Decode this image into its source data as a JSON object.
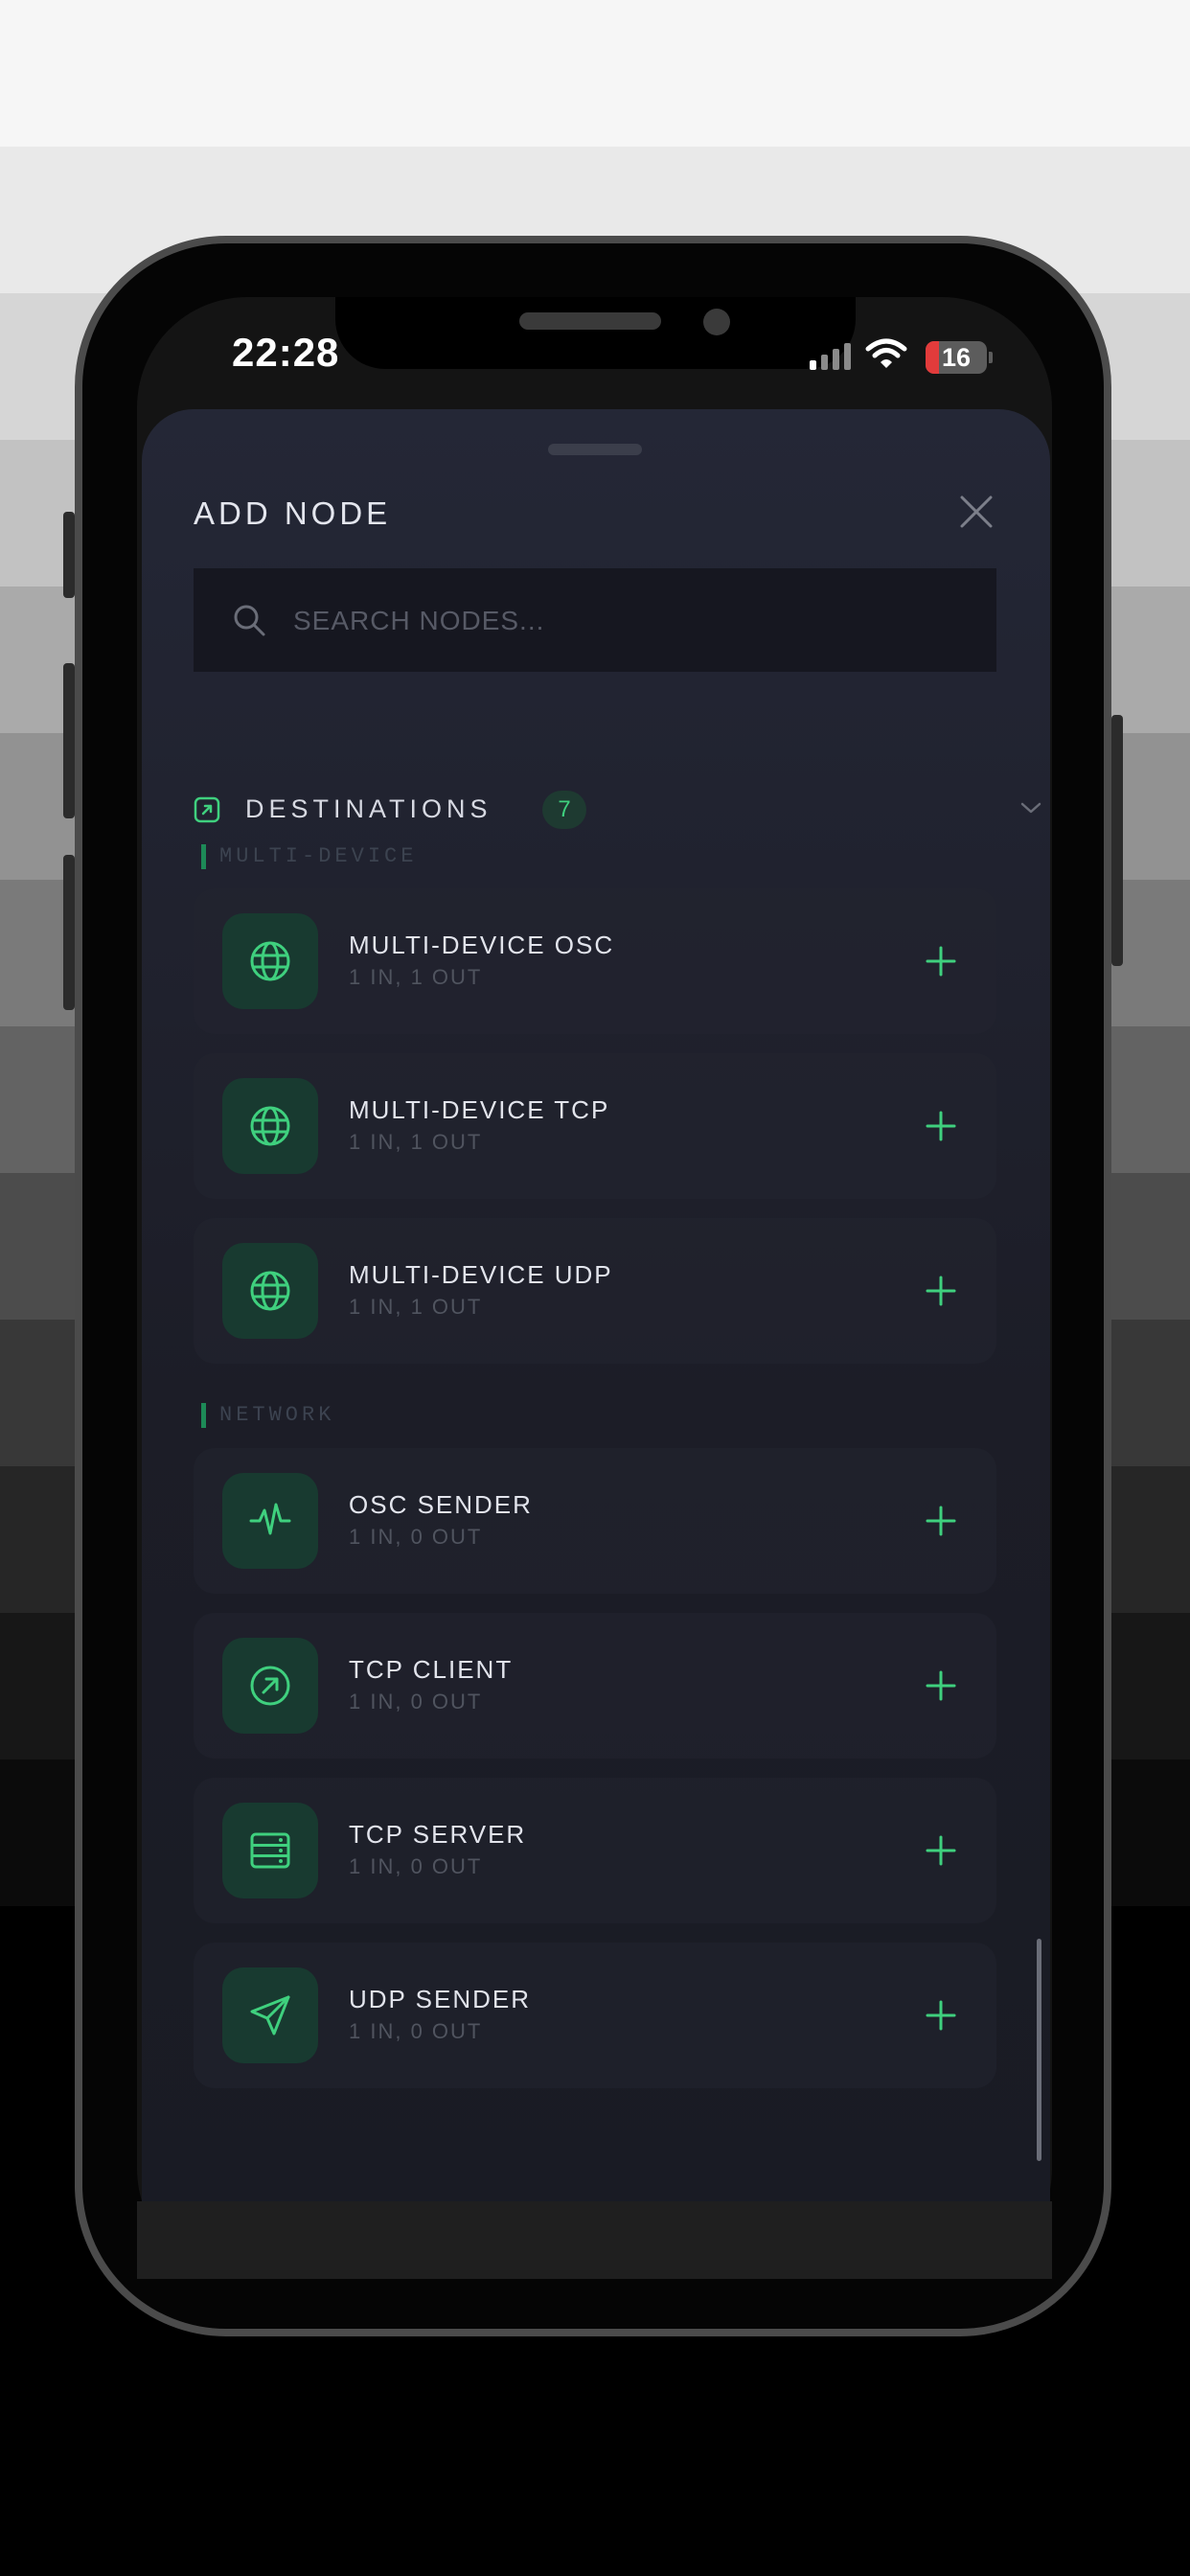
{
  "status_bar": {
    "time": "22:28",
    "battery_level": "16",
    "battery_color": "#e23b3b",
    "icons": [
      "signal-icon",
      "wifi-icon",
      "battery-icon"
    ]
  },
  "sheet": {
    "title": "ADD NODE",
    "close_icon": "close-icon",
    "search_placeholder": "SEARCH NODES...",
    "search_value": ""
  },
  "category": {
    "label": "DESTINATIONS",
    "count": "7",
    "icon": "arrow-up-right-square-icon",
    "expanded_icon": "chevron-down-icon"
  },
  "groups": [
    {
      "label": "MULTI-DEVICE",
      "nodes": [
        {
          "name": "MULTI-DEVICE OSC",
          "ports": "1 IN, 1 OUT",
          "icon": "globe-icon"
        },
        {
          "name": "MULTI-DEVICE TCP",
          "ports": "1 IN, 1 OUT",
          "icon": "globe-icon"
        },
        {
          "name": "MULTI-DEVICE UDP",
          "ports": "1 IN, 1 OUT",
          "icon": "globe-icon"
        }
      ]
    },
    {
      "label": "NETWORK",
      "nodes": [
        {
          "name": "OSC SENDER",
          "ports": "1 IN, 0 OUT",
          "icon": "pulse-icon"
        },
        {
          "name": "TCP CLIENT",
          "ports": "1 IN, 0 OUT",
          "icon": "arrow-up-right-circle-icon"
        },
        {
          "name": "TCP SERVER",
          "ports": "1 IN, 0 OUT",
          "icon": "server-icon"
        },
        {
          "name": "UDP SENDER",
          "ports": "1 IN, 0 OUT",
          "icon": "send-icon"
        }
      ]
    }
  ],
  "colors": {
    "accent": "#3fd07e",
    "sheet_background": "#242736",
    "icon_tile": "#183a30"
  }
}
